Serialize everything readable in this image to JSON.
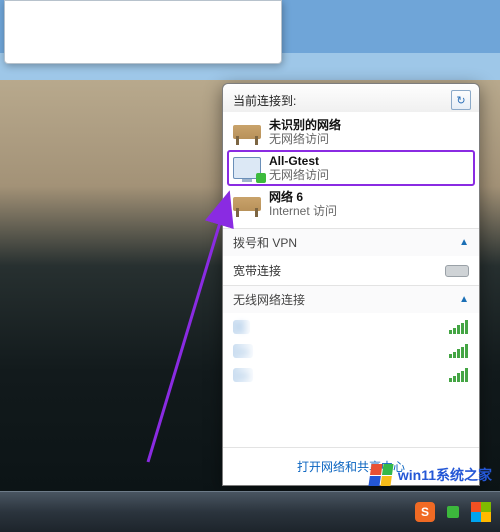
{
  "flyout": {
    "header_title": "当前连接到:",
    "refresh_icon": "↻",
    "connections": [
      {
        "name": "未识别的网络",
        "status": "无网络访问",
        "icon": "bench"
      },
      {
        "name": "All-Gtest",
        "status": "无网络访问",
        "icon": "monitor",
        "highlight": true
      },
      {
        "name": "网络  6",
        "status": "Internet 访问",
        "icon": "bench"
      }
    ],
    "sections": {
      "dial_vpn": {
        "label": "拨号和 VPN",
        "item": "宽带连接"
      },
      "wireless": {
        "label": "无线网络连接",
        "items": [
          {
            "name": "C",
            "bars": 5
          },
          {
            "name": "—",
            "bars": 5
          },
          {
            "name": "—",
            "bars": 5
          }
        ]
      }
    },
    "footer_link": "打开网络和共享中心"
  },
  "taskbar": {
    "sogou_label": "S"
  },
  "watermark": {
    "text": "win11系统之家"
  }
}
